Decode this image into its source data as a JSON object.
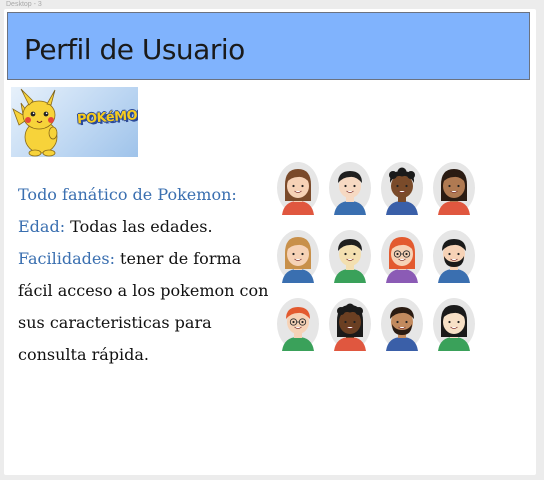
{
  "frame": {
    "label": "Desktop - 3"
  },
  "header": {
    "title": "Perfil de Usuario"
  },
  "banner": {
    "logo_text": "POKéMON"
  },
  "profile": {
    "line1_label": "Todo fanático de Pokemon:",
    "edad_label": "Edad:",
    "edad_value": " Todas las edades.",
    "facilidades_label": "Facilidades:",
    "facilidades_value_line1": " tener de forma",
    "facilidades_value_line2": "fácil acceso a los pokemon con",
    "facilidades_value_line3": "sus caracteristicas para",
    "facilidades_value_line4": "consulta rápida."
  },
  "colors": {
    "header_bg": "#80b3fd",
    "label_blue": "#3a6fb0",
    "pikachu_yellow": "#f7d33a"
  },
  "avatars": [
    {
      "hair": "#7a4a2a",
      "skin": "#f6d2b6",
      "shirt": "#e0573f",
      "style": "long"
    },
    {
      "hair": "#1f1f1f",
      "skin": "#f7d9c2",
      "shirt": "#3a6fb0",
      "style": "short"
    },
    {
      "hair": "#1a1a1a",
      "skin": "#7a4b2a",
      "shirt": "#3a5fa8",
      "style": "curly"
    },
    {
      "hair": "#2a1b12",
      "skin": "#b07a52",
      "shirt": "#e0573f",
      "style": "long"
    },
    {
      "hair": "#c8904a",
      "skin": "#f6d2b6",
      "shirt": "#3a6fb0",
      "style": "long"
    },
    {
      "hair": "#1f1f1f",
      "skin": "#f3dfb0",
      "shirt": "#3aa15a",
      "style": "short"
    },
    {
      "hair": "#e35a2f",
      "skin": "#f6d2b6",
      "shirt": "#8b5bb5",
      "style": "long-glasses"
    },
    {
      "hair": "#1a1a1a",
      "skin": "#f6d2b6",
      "shirt": "#3a6fb0",
      "style": "beard"
    },
    {
      "hair": "#e35a2f",
      "skin": "#f6d2b6",
      "shirt": "#3aa15a",
      "style": "short-glasses"
    },
    {
      "hair": "#1a1a1a",
      "skin": "#6b3f22",
      "shirt": "#e0573f",
      "style": "curly-long"
    },
    {
      "hair": "#2a1b12",
      "skin": "#c28a5e",
      "shirt": "#3a5fa8",
      "style": "beard"
    },
    {
      "hair": "#1a1a1a",
      "skin": "#f7e0c6",
      "shirt": "#3aa15a",
      "style": "long"
    }
  ]
}
